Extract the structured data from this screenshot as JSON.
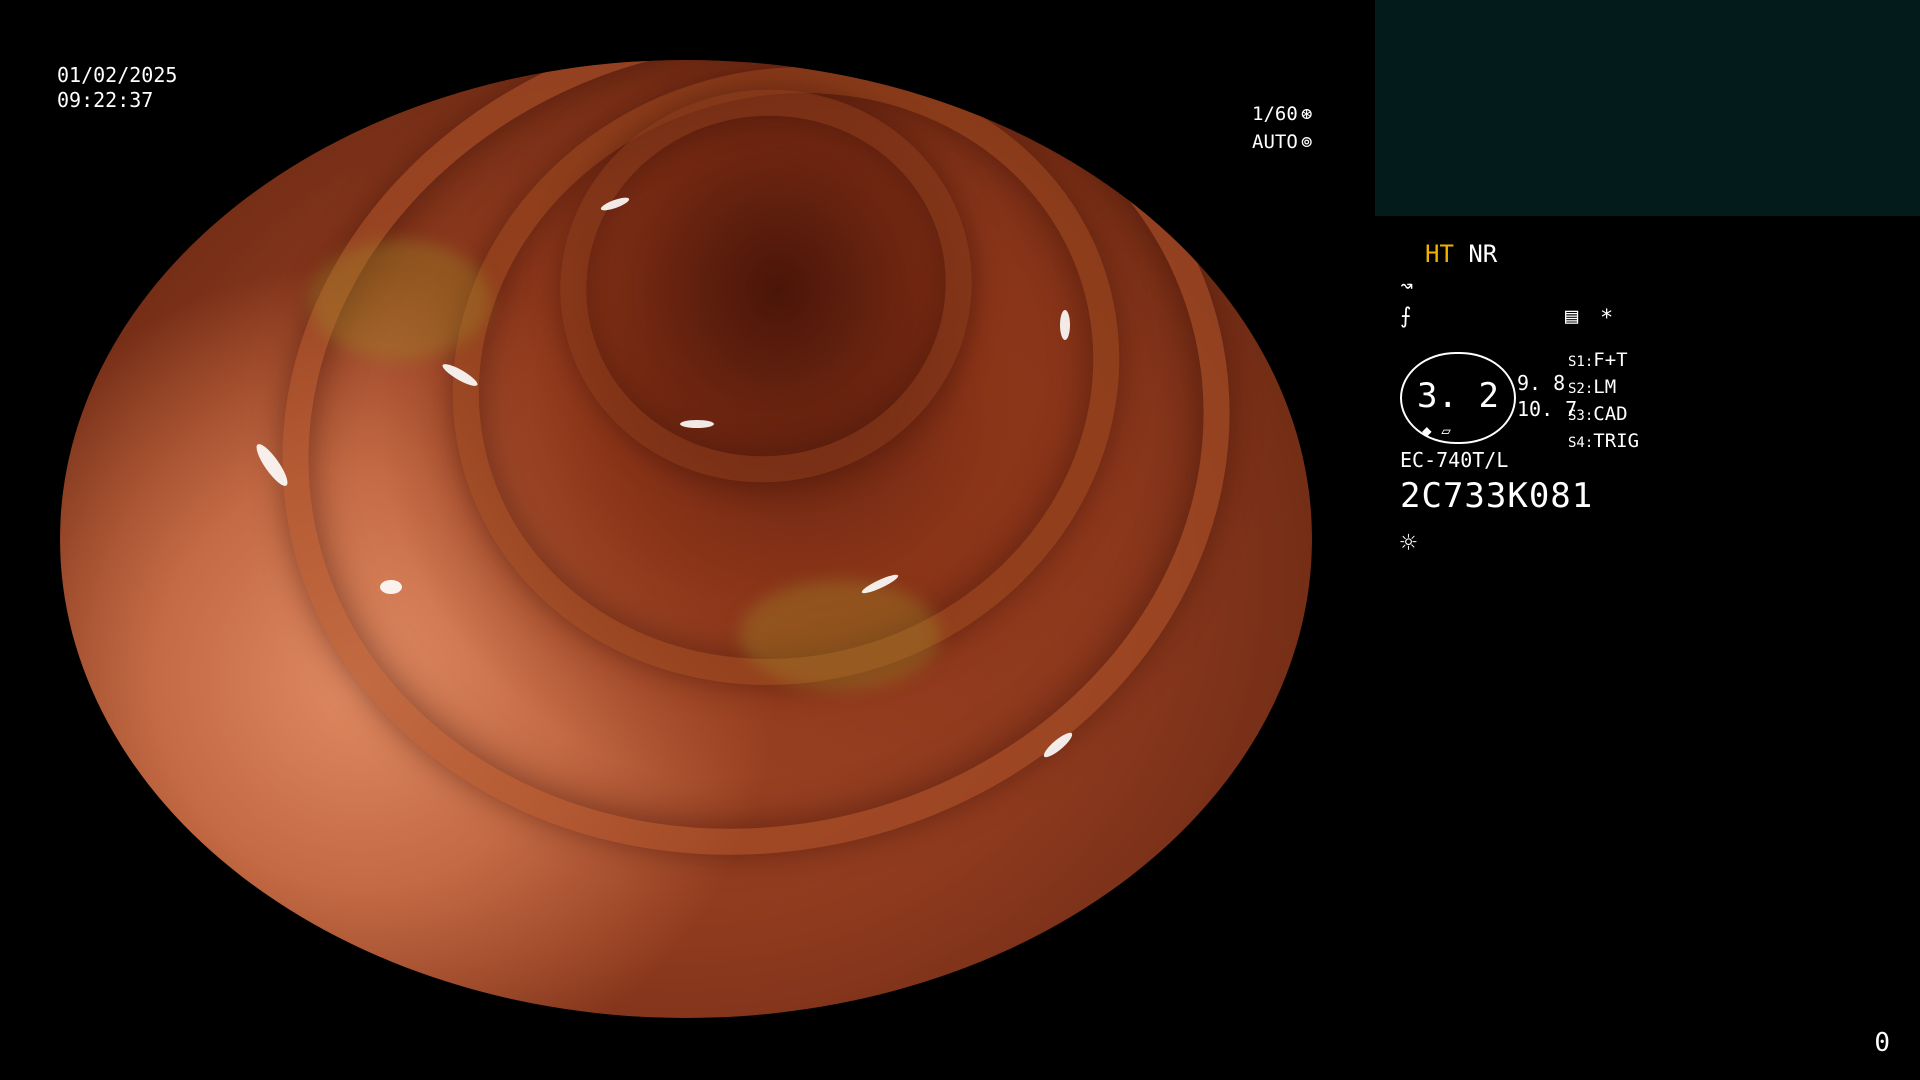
{
  "overlay": {
    "date": "01/02/2025",
    "time": "09:22:37",
    "shutter": "1/60",
    "shutter_icon": "aperture-icon",
    "iris": "AUTO",
    "iris_icon": "iris-icon"
  },
  "panel": {
    "mode_ht": "HT",
    "mode_nr": "NR",
    "icon_1": "↝",
    "icon_2": "⨍",
    "icon_3": "▤",
    "icon_4": "*",
    "gauge_value": "3. 2",
    "gauge_side_top": "9. 8",
    "gauge_side_bottom": "10. 7",
    "slots": [
      {
        "key": "S1:",
        "value": "F+T"
      },
      {
        "key": "S2:",
        "value": "LM"
      },
      {
        "key": "S3:",
        "value": "CAD"
      },
      {
        "key": "S4:",
        "value": "TRIG"
      }
    ],
    "model": "EC-740T/L",
    "serial": "2C733K081",
    "light_icon": "☼"
  },
  "counter": "0",
  "colors": {
    "background": "#000000",
    "thumbnail_bg": "#041b1b",
    "ht_accent": "#f0b400",
    "text": "#ffffff"
  }
}
